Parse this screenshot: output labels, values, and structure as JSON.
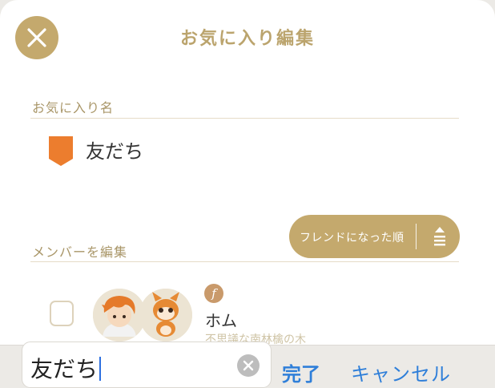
{
  "header": {
    "title": "お気に入り編集",
    "close_icon": "close-icon",
    "accent_color": "#c4a96d"
  },
  "favorite_section": {
    "label": "お気に入り名",
    "icon": "tag-icon",
    "tag_color": "#ec7d2e",
    "name": "友だち"
  },
  "members_section": {
    "label": "メンバーを編集",
    "sort": {
      "label": "フレンドになった順",
      "icon": "sort-icon"
    }
  },
  "member": {
    "badge": "f",
    "name": "ホム",
    "subtitle": "不思議な南林檎の木",
    "checked": false
  },
  "keyboard_bar": {
    "input_value": "友だち",
    "clear_icon": "clear-icon",
    "done_label": "完了",
    "cancel_label": "キャンセル",
    "link_color": "#2f7fd9"
  }
}
